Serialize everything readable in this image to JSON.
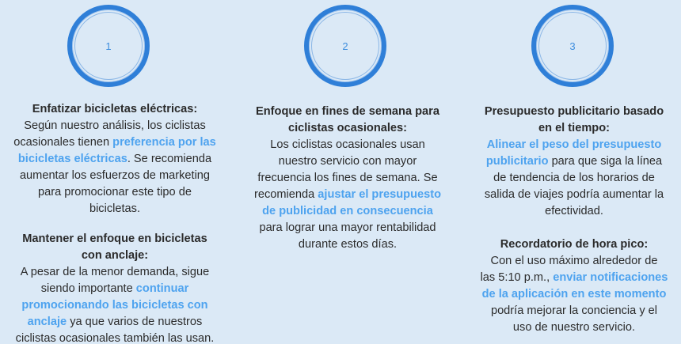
{
  "colors": {
    "background": "#dbe9f6",
    "ring": "#2f7fd8",
    "highlight": "#4ea3ef",
    "text": "#2b2b2b"
  },
  "columns": [
    {
      "number": "1",
      "blocks": [
        {
          "title_lines": [
            "Enfatizar bicicletas eléctricas:"
          ],
          "body": [
            "Según nuestro análisis, los ciclistas",
            "ocasionales tienen ",
            "preferencia por las",
            "bicicletas eléctricas",
            ". Se recomienda",
            "aumentar los esfuerzos de marketing",
            "para promocionar este tipo de",
            "bicicletas."
          ]
        },
        {
          "title_lines": [
            "Mantener el enfoque en bicicletas",
            "con anclaje:"
          ],
          "body": [
            "A pesar de la menor demanda, sigue",
            "siendo importante ",
            "continuar",
            "promocionando las bicicletas con",
            "anclaje",
            " ya que varios de nuestros",
            "ciclistas ocasionales también las usan."
          ]
        }
      ]
    },
    {
      "number": "2",
      "blocks": [
        {
          "title_lines": [
            "Enfoque en fines de semana para",
            "ciclistas ocasionales:"
          ],
          "body": [
            "Los ciclistas ocasionales usan",
            "nuestro servicio con mayor",
            "frecuencia los fines de semana. Se",
            "recomienda ",
            "ajustar el presupuesto",
            "de publicidad en consecuencia",
            "para lograr una mayor rentabilidad",
            "durante estos días."
          ]
        }
      ]
    },
    {
      "number": "3",
      "blocks": [
        {
          "title_lines": [
            "Presupuesto publicitario basado",
            "en el tiempo:"
          ],
          "body": [
            "Alinear el peso del presupuesto",
            "publicitario",
            " para que siga la línea",
            "de tendencia de los horarios de",
            "salida de viajes podría aumentar la",
            "efectividad."
          ]
        },
        {
          "title_lines": [
            "Recordatorio de hora pico:"
          ],
          "body": [
            "Con el uso máximo alrededor de",
            "las 5:10 p.m., ",
            "enviar notificaciones",
            "de la aplicación en este momento",
            "podría mejorar la conciencia y el",
            "uso de nuestro servicio."
          ]
        }
      ]
    }
  ]
}
